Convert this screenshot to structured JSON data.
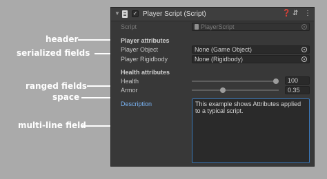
{
  "annotations": {
    "header": "header",
    "serialized_fields": "serialized fields",
    "ranged_fields": "ranged fields",
    "space": "space",
    "multi_line_field": "multi-line field"
  },
  "component": {
    "title": "Player Script (Script)",
    "enabled": true,
    "script_label": "Script",
    "script_value": "PlayerScript"
  },
  "player_section": {
    "header": "Player attributes",
    "player_object": {
      "label": "Player Object",
      "value": "None (Game Object)"
    },
    "player_rigidbody": {
      "label": "Player Rigidbody",
      "value": "None (Rigidbody)"
    }
  },
  "health_section": {
    "header": "Health attributes",
    "health": {
      "label": "Health",
      "value": "100",
      "fraction": 1.0
    },
    "armor": {
      "label": "Armor",
      "value": "0.35",
      "fraction": 0.35
    }
  },
  "description": {
    "label": "Description",
    "value": "This example shows Attributes applied\nto a typical script."
  },
  "icons": [
    "foldout-arrow-icon",
    "script-icon",
    "checkbox-icon",
    "help-icon",
    "presets-icon",
    "more-options-icon",
    "object-picker-icon"
  ],
  "colors": {
    "background": "#aaaaaa",
    "panel": "#383838",
    "accent": "#3a79bb",
    "label_link": "#7ab4f5"
  }
}
